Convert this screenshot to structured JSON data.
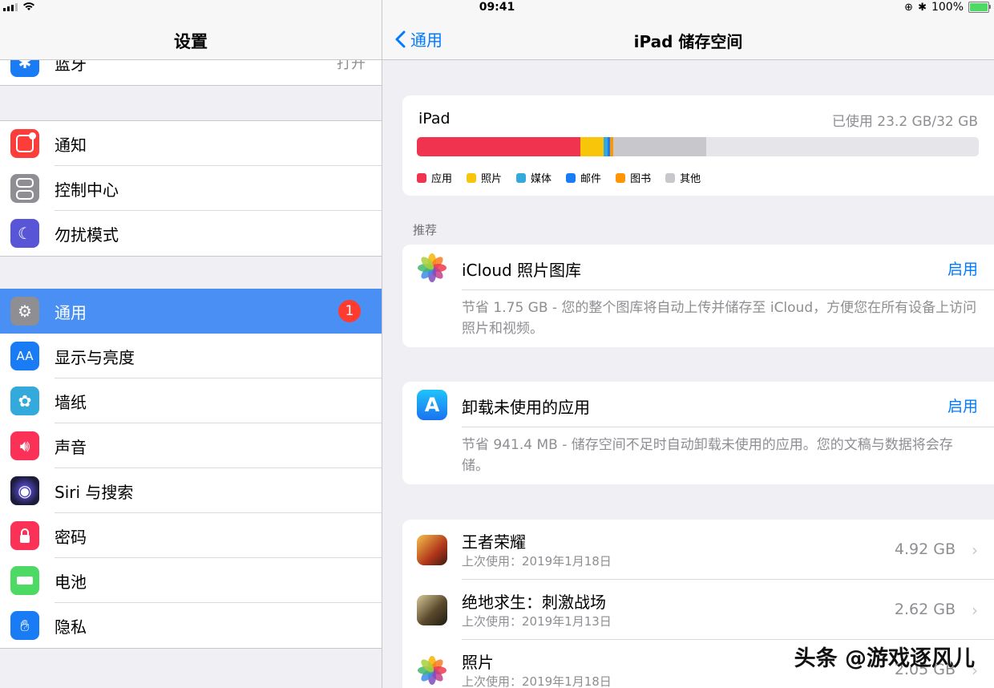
{
  "status_bar": {
    "time": "09:41",
    "battery": "100%"
  },
  "left": {
    "title": "设置",
    "partial_item": {
      "label": "蓝牙",
      "value": "打开"
    },
    "group1": [
      {
        "label": "通知",
        "icon": "notification-icon",
        "color": "#fc3d39"
      },
      {
        "label": "控制中心",
        "icon": "control-center-icon",
        "color": "#8e8e93"
      },
      {
        "label": "勿扰模式",
        "icon": "moon-icon",
        "color": "#5856d6"
      }
    ],
    "group2": [
      {
        "label": "通用",
        "icon": "gear-icon",
        "color": "#8e8e93",
        "selected": true,
        "badge": "1"
      },
      {
        "label": "显示与亮度",
        "icon": "display-icon",
        "color": "#1a7cf5"
      },
      {
        "label": "墙纸",
        "icon": "wallpaper-icon",
        "color": "#34aadc"
      },
      {
        "label": "声音",
        "icon": "speaker-icon",
        "color": "#fc3158"
      },
      {
        "label": "Siri 与搜索",
        "icon": "siri-icon",
        "color": "#222222"
      },
      {
        "label": "密码",
        "icon": "lock-icon",
        "color": "#fc3158"
      },
      {
        "label": "电池",
        "icon": "battery-icon",
        "color": "#4cd964"
      },
      {
        "label": "隐私",
        "icon": "hand-icon",
        "color": "#1a7cf5"
      }
    ]
  },
  "right": {
    "back_label": "通用",
    "title": "iPad 储存空间",
    "storage": {
      "device": "iPad",
      "used": "已使用 23.2 GB/32 GB",
      "segments": [
        {
          "name": "应用",
          "color": "#f0344f",
          "gb": 9.3
        },
        {
          "name": "照片",
          "color": "#f8c50b",
          "gb": 1.35
        },
        {
          "name": "媒体",
          "color": "#34aadc",
          "gb": 0.2
        },
        {
          "name": "邮件",
          "color": "#1a7cf5",
          "gb": 0.15
        },
        {
          "name": "图书",
          "color": "#ff9500",
          "gb": 0.2
        },
        {
          "name": "其他",
          "color": "#c7c7cc",
          "gb": 5.3
        }
      ]
    },
    "section_header": "推荐",
    "recommendations": [
      {
        "title": "iCloud 照片图库",
        "action": "启用",
        "desc": "节省 1.75 GB - 您的整个图库将自动上传并储存至 iCloud，方便您在所有设备上访问照片和视频。"
      },
      {
        "title": "卸载未使用的应用",
        "action": "启用",
        "desc": "节省 941.4 MB - 储存空间不足时自动卸载未使用的应用。您的文稿与数据将会存储。"
      }
    ],
    "apps": [
      {
        "name": "王者荣耀",
        "last_used": "上次使用：2019年1月18日",
        "size": "4.92 GB"
      },
      {
        "name": "绝地求生：刺激战场",
        "last_used": "上次使用：2019年1月13日",
        "size": "2.62 GB"
      },
      {
        "name": "照片",
        "last_used": "上次使用：2019年1月18日",
        "size": "2.05 GB"
      }
    ]
  },
  "watermark": "头条 @游戏逐风儿"
}
